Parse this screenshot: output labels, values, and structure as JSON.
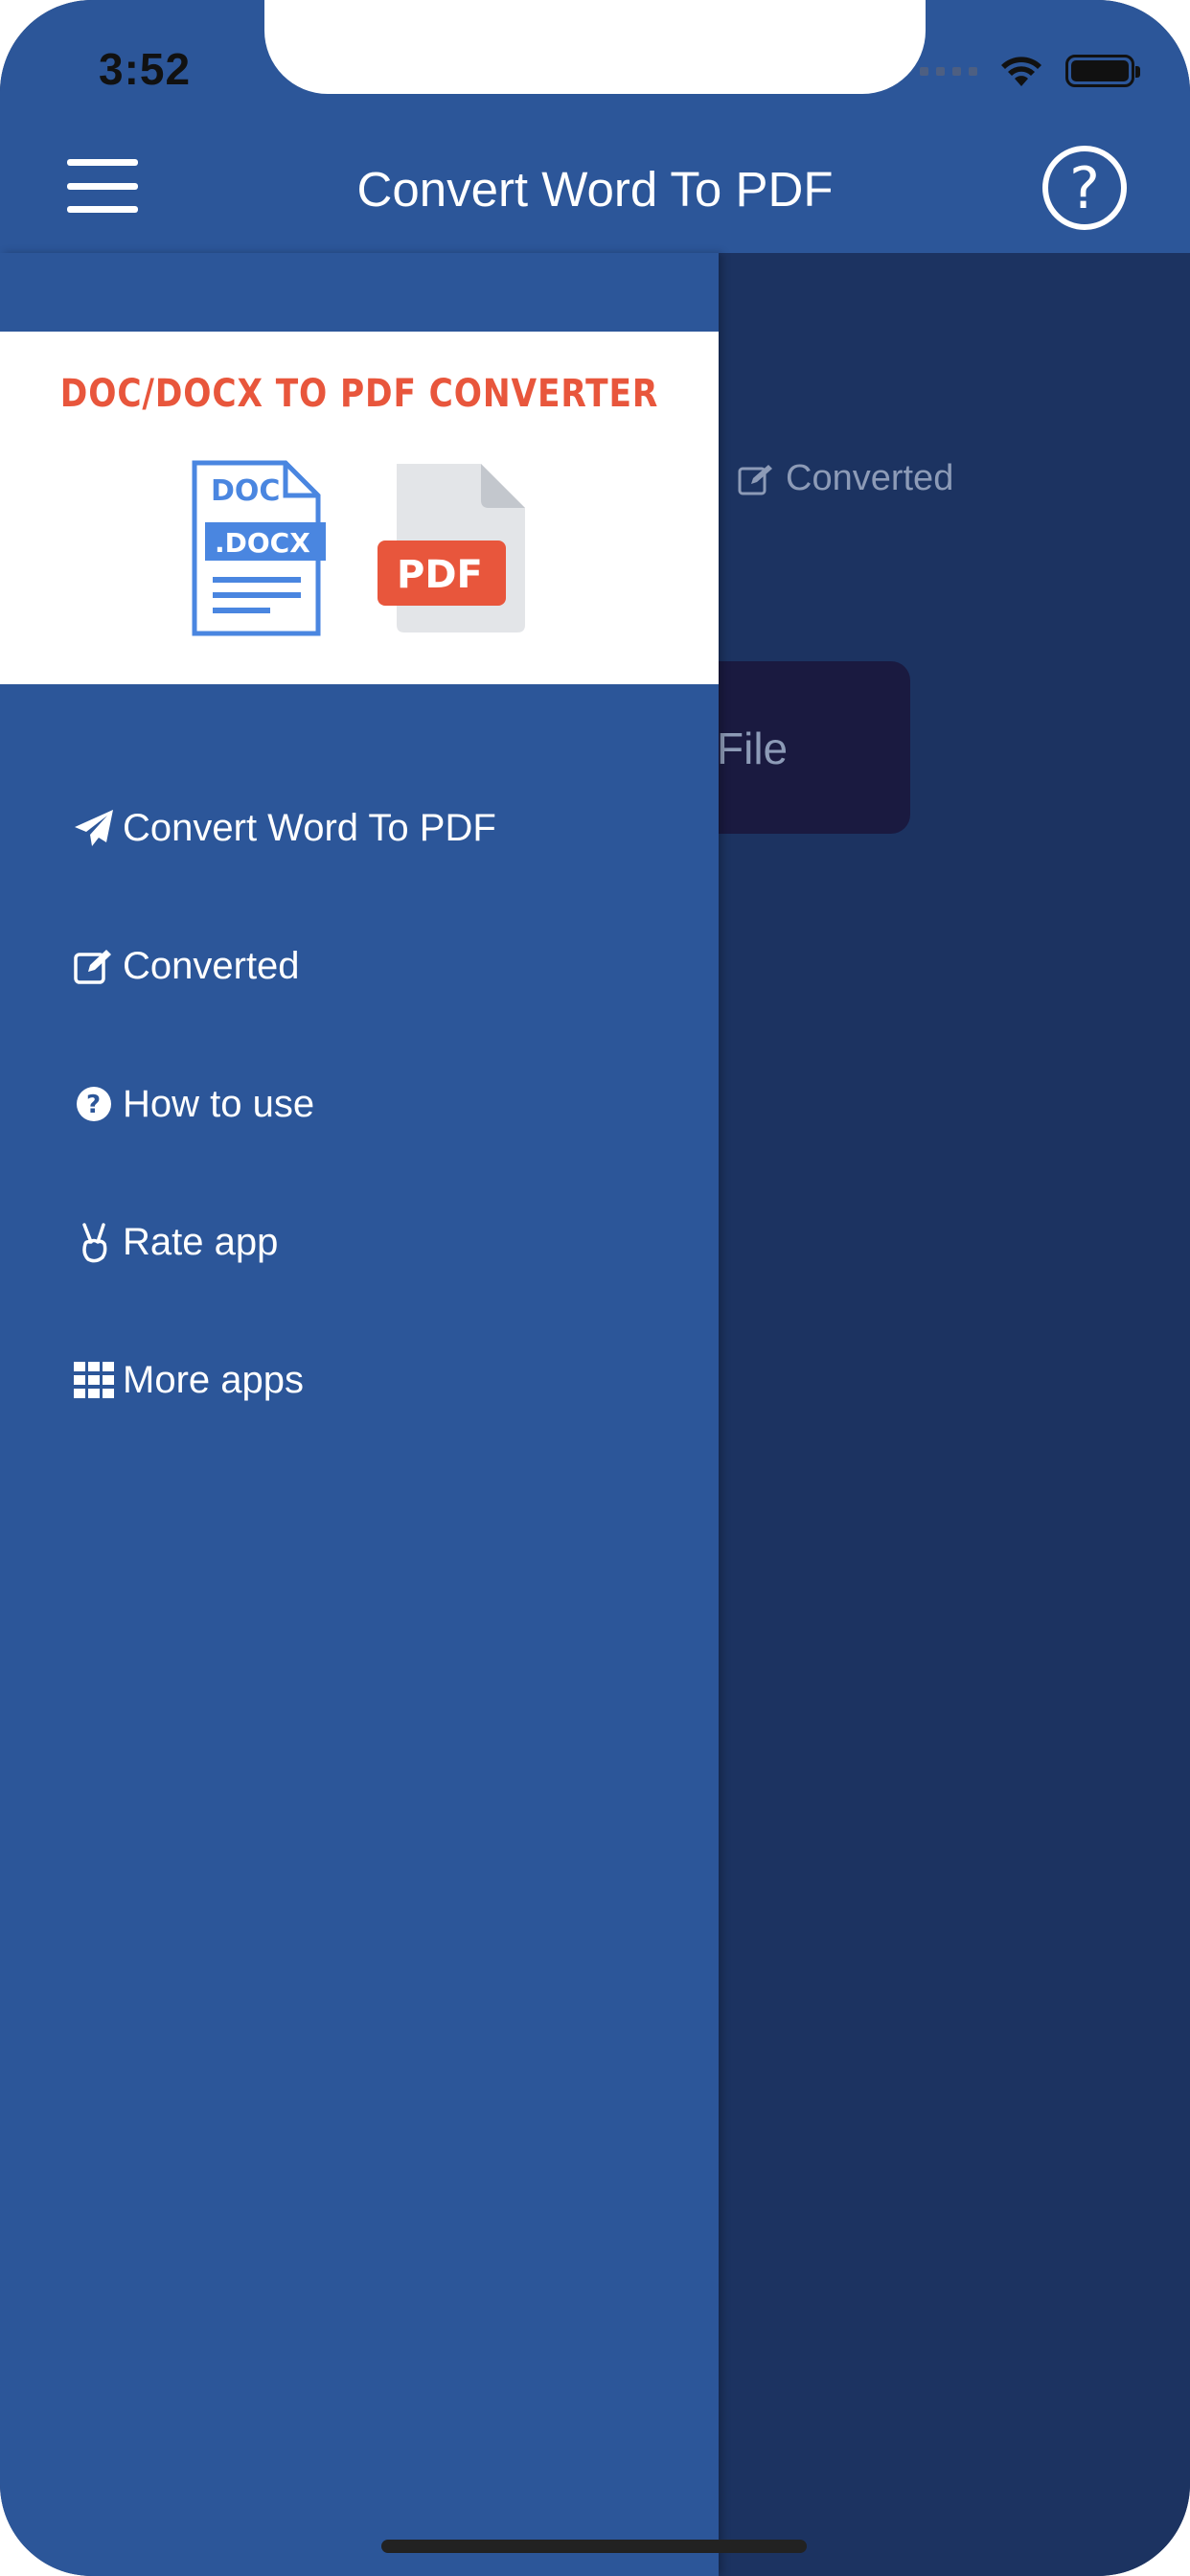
{
  "status_bar": {
    "time": "3:52"
  },
  "header": {
    "title": "Convert Word To PDF",
    "help_label": "?"
  },
  "main": {
    "tab_converted": "Converted",
    "select_button_label": "File"
  },
  "drawer": {
    "banner": {
      "title": "DOC/DOCX TO PDF CONVERTER",
      "doc_label": "DOC",
      "docx_label": ".DOCX",
      "pdf_label": "PDF"
    },
    "items": [
      {
        "label": "Convert Word To PDF",
        "icon": "paper-plane-icon"
      },
      {
        "label": "Converted",
        "icon": "edit-icon"
      },
      {
        "label": "How to use",
        "icon": "question-circle-icon"
      },
      {
        "label": "Rate app",
        "icon": "victory-hand-icon"
      },
      {
        "label": "More apps",
        "icon": "grid-icon"
      }
    ]
  },
  "colors": {
    "header": "#2c5699",
    "drawer": "#2c5699",
    "dim_overlay": "#1c3361",
    "banner_title": "#e8563c",
    "docx_blue": "#4a86e0",
    "pdf_red": "#e8563c"
  }
}
